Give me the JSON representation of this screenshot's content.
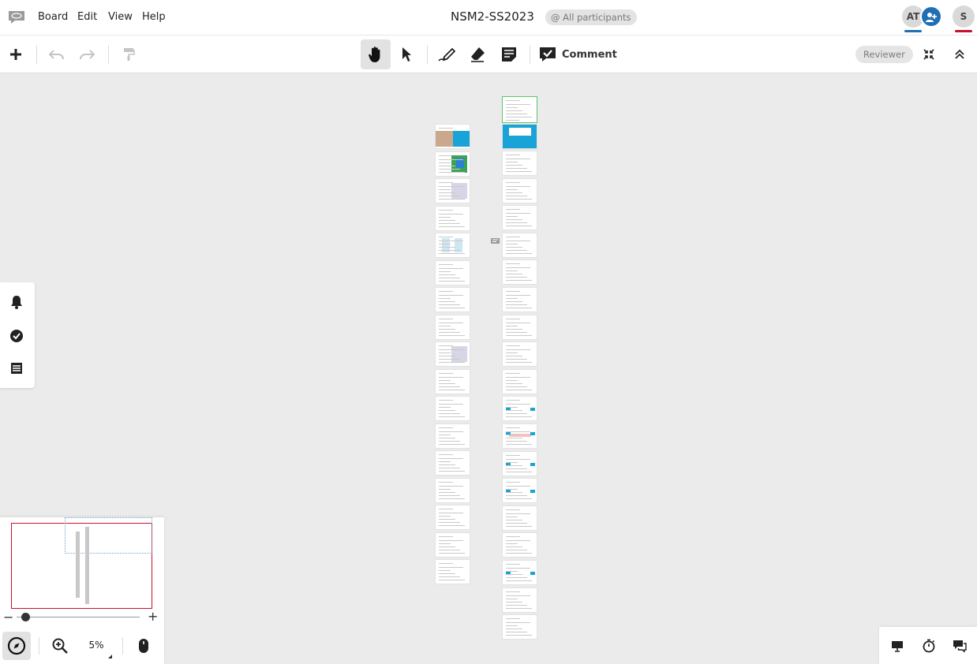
{
  "menubar": {
    "logo_icon": "speech-bubble-logo-icon",
    "menu": [
      "Board",
      "Edit",
      "View",
      "Help"
    ],
    "board_title": "NSM2-SS2023",
    "participants_label": "@ All participants",
    "avatars": [
      {
        "initials": "AT",
        "color": "#d9d9d9",
        "underline": "#1f6fb5"
      },
      {
        "initials": "S",
        "color": "#d9d9d9",
        "underline": "#c8102e"
      }
    ],
    "invite_icon": "add-user-icon",
    "invite_color": "#1f6fb5"
  },
  "toolbar": {
    "tools": [
      {
        "name": "add-icon",
        "disabled": false
      },
      {
        "name": "undo-icon",
        "disabled": true
      },
      {
        "name": "redo-icon",
        "disabled": true
      },
      {
        "name": "format-painter-icon",
        "disabled": true
      },
      {
        "name": "hand-pan-icon",
        "active": true
      },
      {
        "name": "select-pointer-icon"
      },
      {
        "name": "pen-icon"
      },
      {
        "name": "eraser-icon"
      },
      {
        "name": "sticky-note-icon"
      }
    ],
    "comment_label": "Comment",
    "reviewer_label": "Reviewer",
    "right_icons": [
      "fit-screen-icon",
      "collapse-up-icon"
    ]
  },
  "canvas": {
    "comment_marker_icon": "comment-marker-icon"
  },
  "sidebar": {
    "icons": [
      "bell-icon",
      "check-circle-icon",
      "list-icon"
    ]
  },
  "minimap": {
    "zoom_level": "5%",
    "zoom_minus": "−",
    "zoom_plus": "+",
    "zoom_fraction": 0.04,
    "icons": [
      "navigator-compass-icon",
      "zoom-in-icon",
      "mouse-icon"
    ]
  },
  "bottom_right": {
    "icons": [
      "presentation-icon",
      "timer-icon",
      "chat-icon"
    ]
  },
  "colors": {
    "accent": "#1f6fb5",
    "frame_red": "#c8102e",
    "page_cyan": "#1aa3d6",
    "first_page_border": "#5fc46a"
  }
}
